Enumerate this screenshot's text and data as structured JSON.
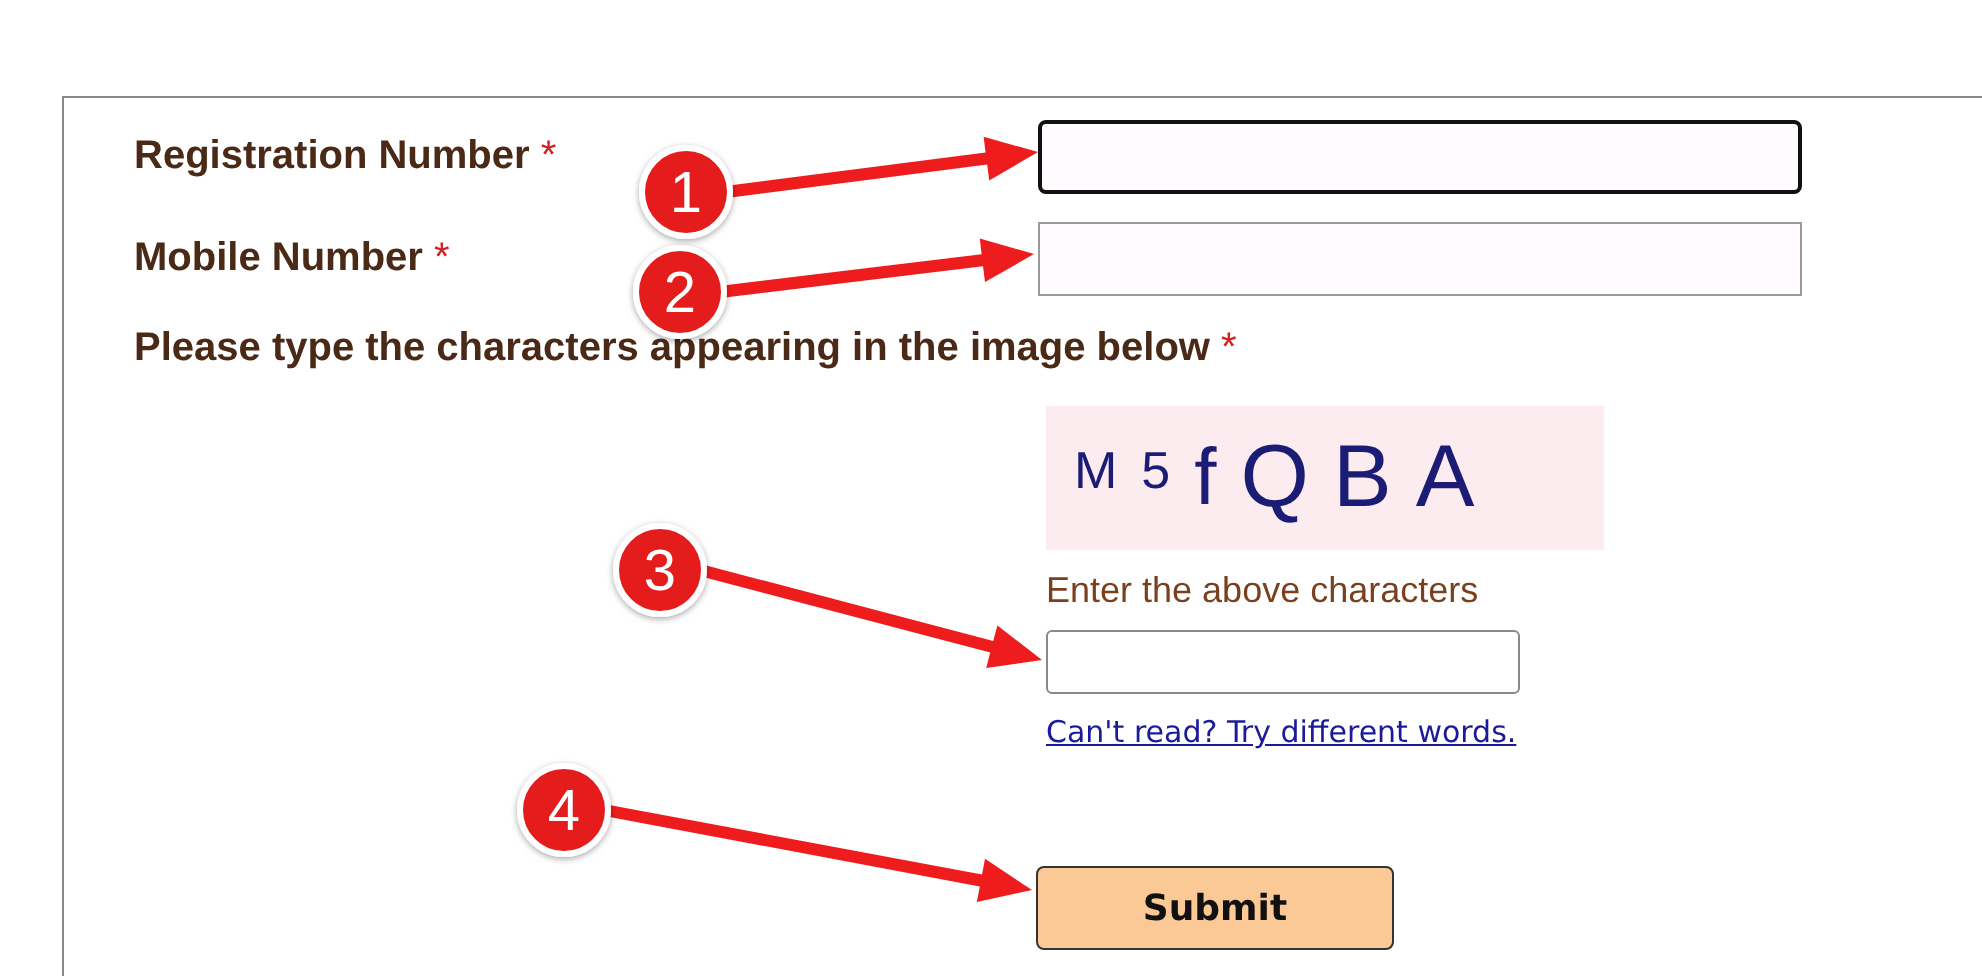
{
  "form": {
    "fields": [
      {
        "label": "Registration Number",
        "required": "*",
        "focused": true
      },
      {
        "label": "Mobile Number",
        "required": "*",
        "focused": false
      }
    ],
    "captcha": {
      "label": "Please type the characters appearing in the image below",
      "required": "*",
      "characters": [
        "M",
        "5",
        "f",
        "Q",
        "B",
        "A"
      ],
      "hint": "Enter the above characters",
      "link": "Can't read? Try different words."
    },
    "submit": "Submit"
  },
  "annotations": [
    {
      "number": "1"
    },
    {
      "number": "2"
    },
    {
      "number": "3"
    },
    {
      "number": "4"
    }
  ]
}
